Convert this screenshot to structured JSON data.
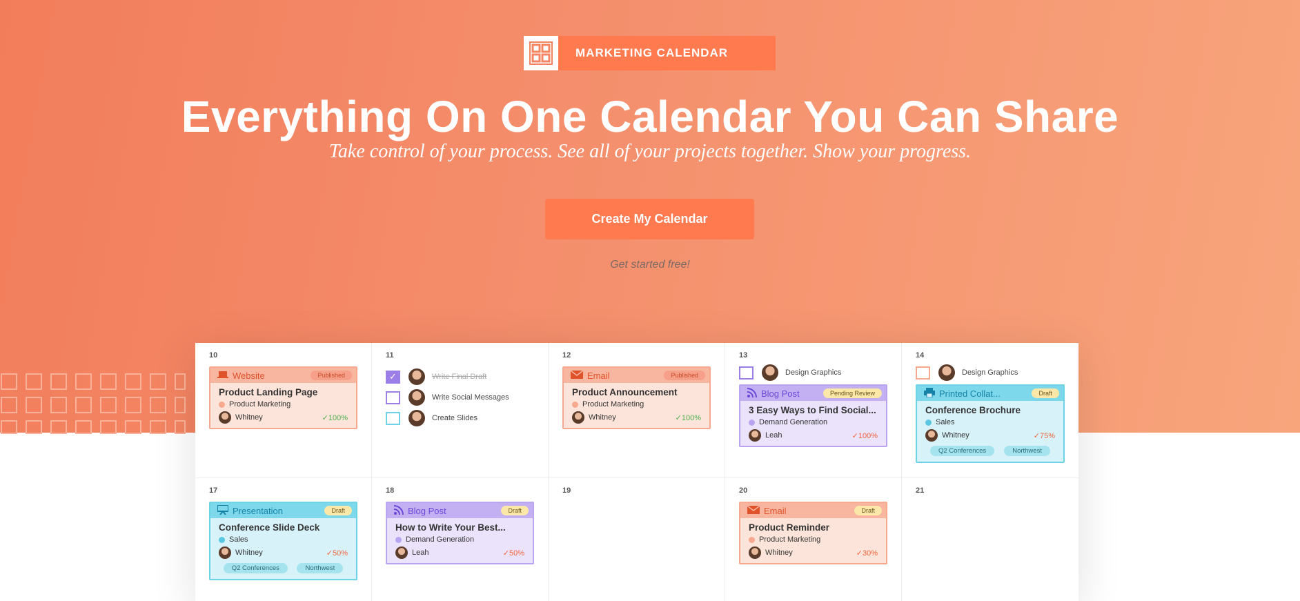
{
  "brand": {
    "label": "MARKETING CALENDAR",
    "logo_icon": "calendar-grid-icon"
  },
  "hero": {
    "headline": "Everything On One Calendar You Can Share",
    "subline": "Take control of your process. See all of your projects together. Show your progress.",
    "cta_label": "Create My Calendar",
    "cta_note": "Get started free!"
  },
  "colors": {
    "hero_start": "#f27d5b",
    "hero_end": "#f8a57c",
    "accent": "#ff7a4f"
  },
  "calendar": {
    "days": {
      "d10": "10",
      "d11": "11",
      "d12": "12",
      "d13": "13",
      "d14": "14",
      "d17": "17",
      "d18": "18",
      "d19": "19",
      "d20": "20",
      "d21": "21"
    },
    "c10": {
      "type": "Website",
      "status": "Published",
      "title": "Product Landing Page",
      "team": "Product Marketing",
      "owner": "Whitney",
      "progress": "100%"
    },
    "tasks11": [
      {
        "label": "Write Final Draft",
        "done": true
      },
      {
        "label": "Write Social Messages",
        "done": false
      },
      {
        "label": "Create Slides",
        "done": false
      }
    ],
    "c12": {
      "type": "Email",
      "status": "Published",
      "title": "Product Announcement",
      "team": "Product Marketing",
      "owner": "Whitney",
      "progress": "100%"
    },
    "task13": "Design Graphics",
    "c13": {
      "type": "Blog Post",
      "status": "Pending Review",
      "title": "3 Easy Ways to Find Social...",
      "team": "Demand Generation",
      "owner": "Leah",
      "progress": "100%"
    },
    "task14": "Design Graphics",
    "c14": {
      "type": "Printed Collat...",
      "status": "Draft",
      "title": "Conference Brochure",
      "team": "Sales",
      "owner": "Whitney",
      "progress": "75%",
      "tags": [
        "Q2 Conferences",
        "Northwest"
      ]
    },
    "c17": {
      "type": "Presentation",
      "status": "Draft",
      "title": "Conference Slide Deck",
      "team": "Sales",
      "owner": "Whitney",
      "progress": "50%",
      "tags": [
        "Q2 Conferences",
        "Northwest"
      ]
    },
    "c18": {
      "type": "Blog Post",
      "status": "Draft",
      "title": "How to Write Your Best...",
      "team": "Demand Generation",
      "owner": "Leah",
      "progress": "50%"
    },
    "c20": {
      "type": "Email",
      "status": "Draft",
      "title": "Product Reminder",
      "team": "Product Marketing",
      "owner": "Whitney",
      "progress": "30%"
    }
  }
}
